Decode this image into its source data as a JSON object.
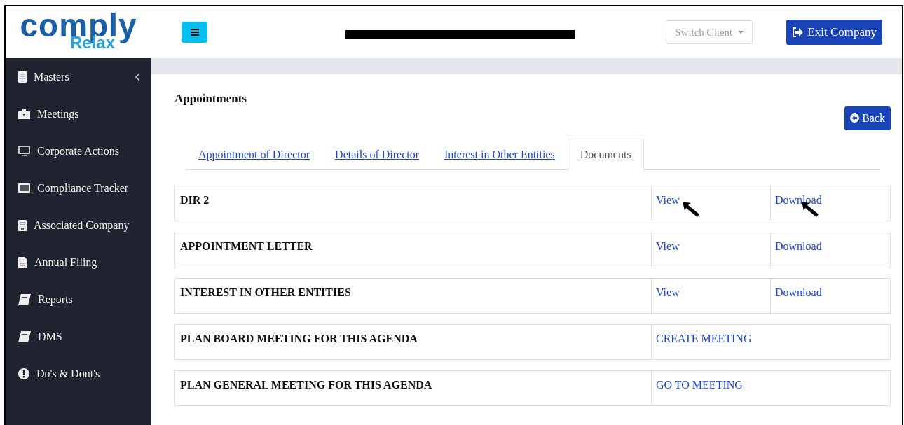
{
  "logo": {
    "line_1": "comply",
    "line_2": "Relax"
  },
  "sidebar": {
    "items": [
      {
        "label": "Masters",
        "collapsible": true
      },
      {
        "label": "Meetings",
        "collapsible": false
      },
      {
        "label": "Corporate Actions",
        "collapsible": false
      },
      {
        "label": "Compliance Tracker",
        "collapsible": false
      },
      {
        "label": "Associated Company",
        "collapsible": false
      },
      {
        "label": "Annual Filing",
        "collapsible": false
      },
      {
        "label": "Reports",
        "collapsible": false
      },
      {
        "label": "DMS",
        "collapsible": false
      },
      {
        "label": "Do's & Dont's",
        "collapsible": false
      }
    ]
  },
  "header": {
    "switch_client": "Switch Client",
    "exit_button": "Exit Company"
  },
  "page": {
    "title": "Appointments",
    "back_button": "Back",
    "tabs": [
      {
        "label": "Appointment of Director",
        "selected": false
      },
      {
        "label": "Details of Director",
        "selected": false
      },
      {
        "label": "Interest in Other Entities",
        "selected": false
      },
      {
        "label": "Documents",
        "selected": true
      }
    ],
    "documents": [
      {
        "name": "DIR 2",
        "actions": [
          {
            "label": "View",
            "cursor": true
          },
          {
            "label": "Download",
            "cursor": true
          }
        ]
      },
      {
        "name": "APPOINTMENT LETTER",
        "actions": [
          {
            "label": "View",
            "cursor": false
          },
          {
            "label": "Download",
            "cursor": false
          }
        ]
      },
      {
        "name": "INTEREST IN OTHER ENTITIES",
        "actions": [
          {
            "label": "View",
            "cursor": false
          },
          {
            "label": "Download",
            "cursor": false
          }
        ]
      },
      {
        "name": "PLAN BOARD MEETING FOR THIS AGENDA",
        "actions": [
          {
            "label": "CREATE MEETING",
            "cursor": false
          }
        ]
      },
      {
        "name": "PLAN GENERAL MEETING FOR THIS AGENDA",
        "actions": [
          {
            "label": "GO TO MEETING",
            "cursor": false
          }
        ]
      }
    ]
  }
}
